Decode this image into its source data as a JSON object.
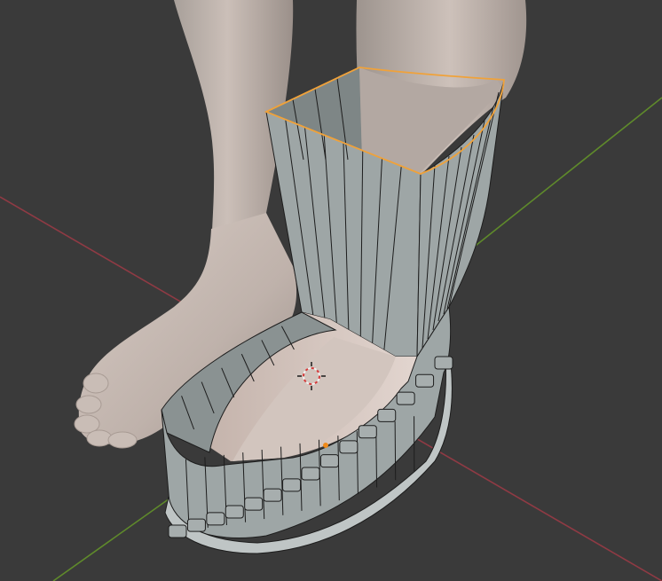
{
  "viewport": {
    "background": "#3a3a3a",
    "axes": {
      "x_axis_color": "#8f3a44",
      "y_axis_color": "#5f8a2b"
    },
    "scene": {
      "skin_color": "#cdbfb8",
      "skin_shadow_color": "#9f9089",
      "mesh_face_color": "#9ea6a6",
      "mesh_inner_color": "#8a9292",
      "wire_color": "#1d1d1d",
      "selected_edge_color": "#f0a23a",
      "origin_point_color": "#f08a1a",
      "cursor_primary_color": "#d63b3b",
      "cursor_secondary_color": "#f2f2f2"
    }
  }
}
